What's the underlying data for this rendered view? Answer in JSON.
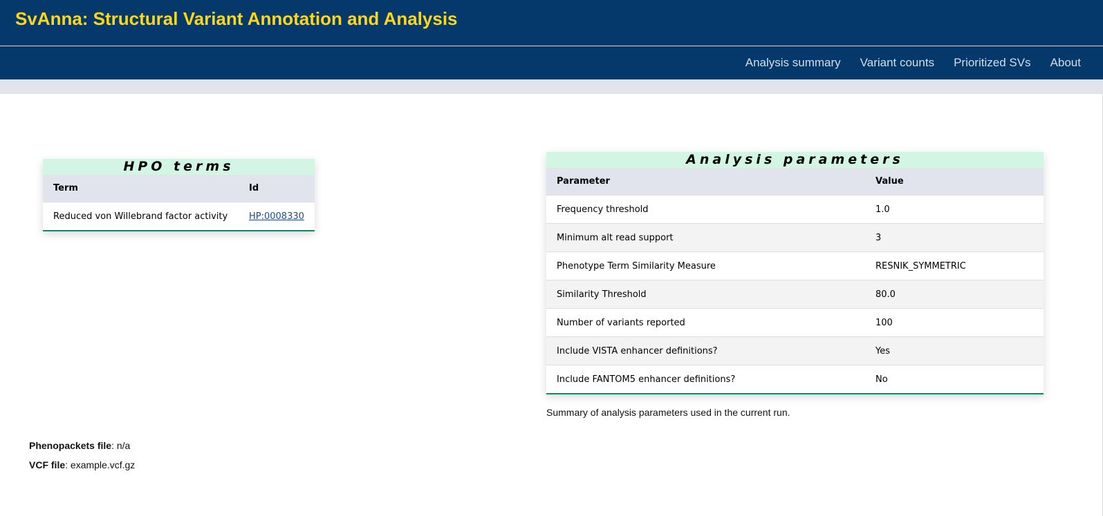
{
  "header": {
    "title": "SvAnna: Structural Variant Annotation and Analysis"
  },
  "nav": {
    "items": [
      {
        "label": "Analysis summary"
      },
      {
        "label": "Variant counts"
      },
      {
        "label": "Prioritized SVs"
      },
      {
        "label": "About"
      }
    ]
  },
  "hpo": {
    "title": "HPO terms",
    "columns": [
      "Term",
      "Id"
    ],
    "rows": [
      {
        "term": "Reduced von Willebrand factor activity",
        "id": "HP:0008330"
      }
    ]
  },
  "params": {
    "title": "Analysis parameters",
    "columns": [
      "Parameter",
      "Value"
    ],
    "rows": [
      {
        "name": "Frequency threshold",
        "value": "1.0"
      },
      {
        "name": "Minimum alt read support",
        "value": "3"
      },
      {
        "name": "Phenotype Term Similarity Measure",
        "value": "RESNIK_SYMMETRIC"
      },
      {
        "name": "Similarity Threshold",
        "value": "80.0"
      },
      {
        "name": "Number of variants reported",
        "value": "100"
      },
      {
        "name": "Include VISTA enhancer definitions?",
        "value": "Yes"
      },
      {
        "name": "Include FANTOM5 enhancer definitions?",
        "value": "No"
      }
    ],
    "caption": "Summary of analysis parameters used in the current run."
  },
  "files": {
    "phenopackets_label": "Phenopackets file",
    "phenopackets_value": ": n/a",
    "vcf_label": "VCF file",
    "vcf_value": ": example.vcf.gz"
  },
  "colors": {
    "header_bg": "#05386b",
    "title_color": "#ffd814",
    "card_title_bg": "#d3f5e3",
    "accent": "#0b8a6a"
  }
}
